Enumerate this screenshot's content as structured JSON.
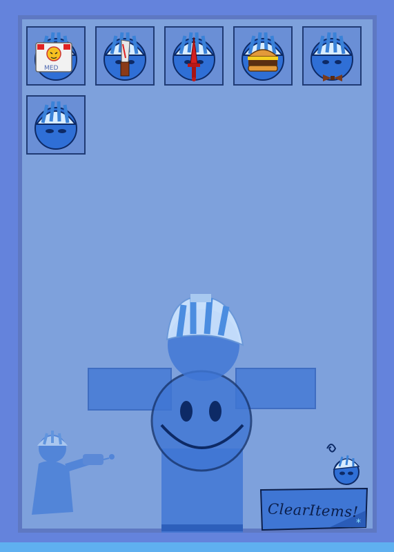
{
  "inventory": {
    "slots": [
      {
        "item": "medkit-icon",
        "badge": "MED"
      },
      {
        "item": "knife-icon"
      },
      {
        "item": "dagger-icon"
      },
      {
        "item": "burger-icon"
      },
      {
        "item": "bowtie-icon"
      },
      {
        "item": "hat-only-icon"
      }
    ]
  },
  "controls": {
    "clear_label": "ClearItems!"
  },
  "colors": {
    "background": "#6483dc",
    "panel": "#7ea1dc",
    "panel_border": "#5e78c2",
    "slot_border": "#1f3a73",
    "character_blue": "#2f6fd6",
    "hat_stripe_light": "#d8ecff",
    "hat_stripe_dark": "#3a82d8"
  }
}
